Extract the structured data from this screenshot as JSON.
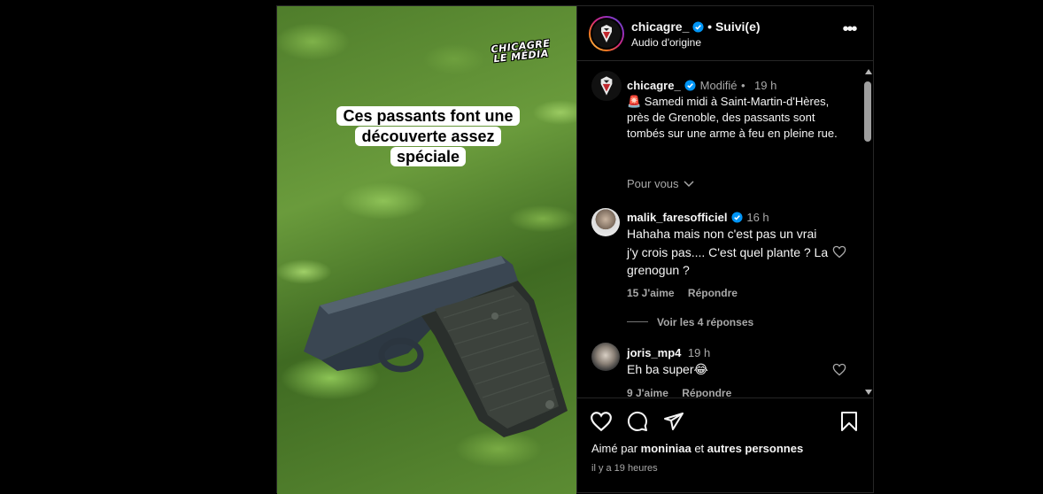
{
  "media": {
    "watermark_line1": "CHICAGRE",
    "watermark_line2": "LE MÉDIA",
    "caption": "Ces passants font une découverte assez spéciale"
  },
  "header": {
    "username": "chicagre_",
    "separator": "•",
    "follow_status": "Suivi(e)",
    "audio": "Audio d'origine",
    "more": "•••"
  },
  "post": {
    "username": "chicagre_",
    "edited": "Modifié",
    "dot": "•",
    "time": "19 h",
    "caption": "🚨 Samedi midi à Saint-Martin-d'Hères, près de Grenoble, des passants sont tombés sur une arme à feu en pleine rue.",
    "for_you": "Pour vous"
  },
  "comments": [
    {
      "username": "malik_faresofficiel",
      "time": "16 h",
      "text": "Hahaha mais non c'est pas un vrai j'y crois pas.... C'est quel plante ? La grenogun ?",
      "likes": "15 J'aime",
      "reply": "Répondre",
      "view_replies": "Voir les 4 réponses"
    },
    {
      "username": "joris_mp4",
      "time": "19 h",
      "text": "Eh ba super😂",
      "likes": "9 J'aime",
      "reply": "Répondre"
    }
  ],
  "footer": {
    "liked_prefix": "Aimé par ",
    "liked_user": "moniniaa",
    "liked_mid": " et ",
    "liked_others": "autres personnes",
    "time_ago": "il y a 19 heures"
  },
  "colors": {
    "verified": "#0095f6",
    "muted": "#a8a8a8",
    "border": "#262626"
  }
}
